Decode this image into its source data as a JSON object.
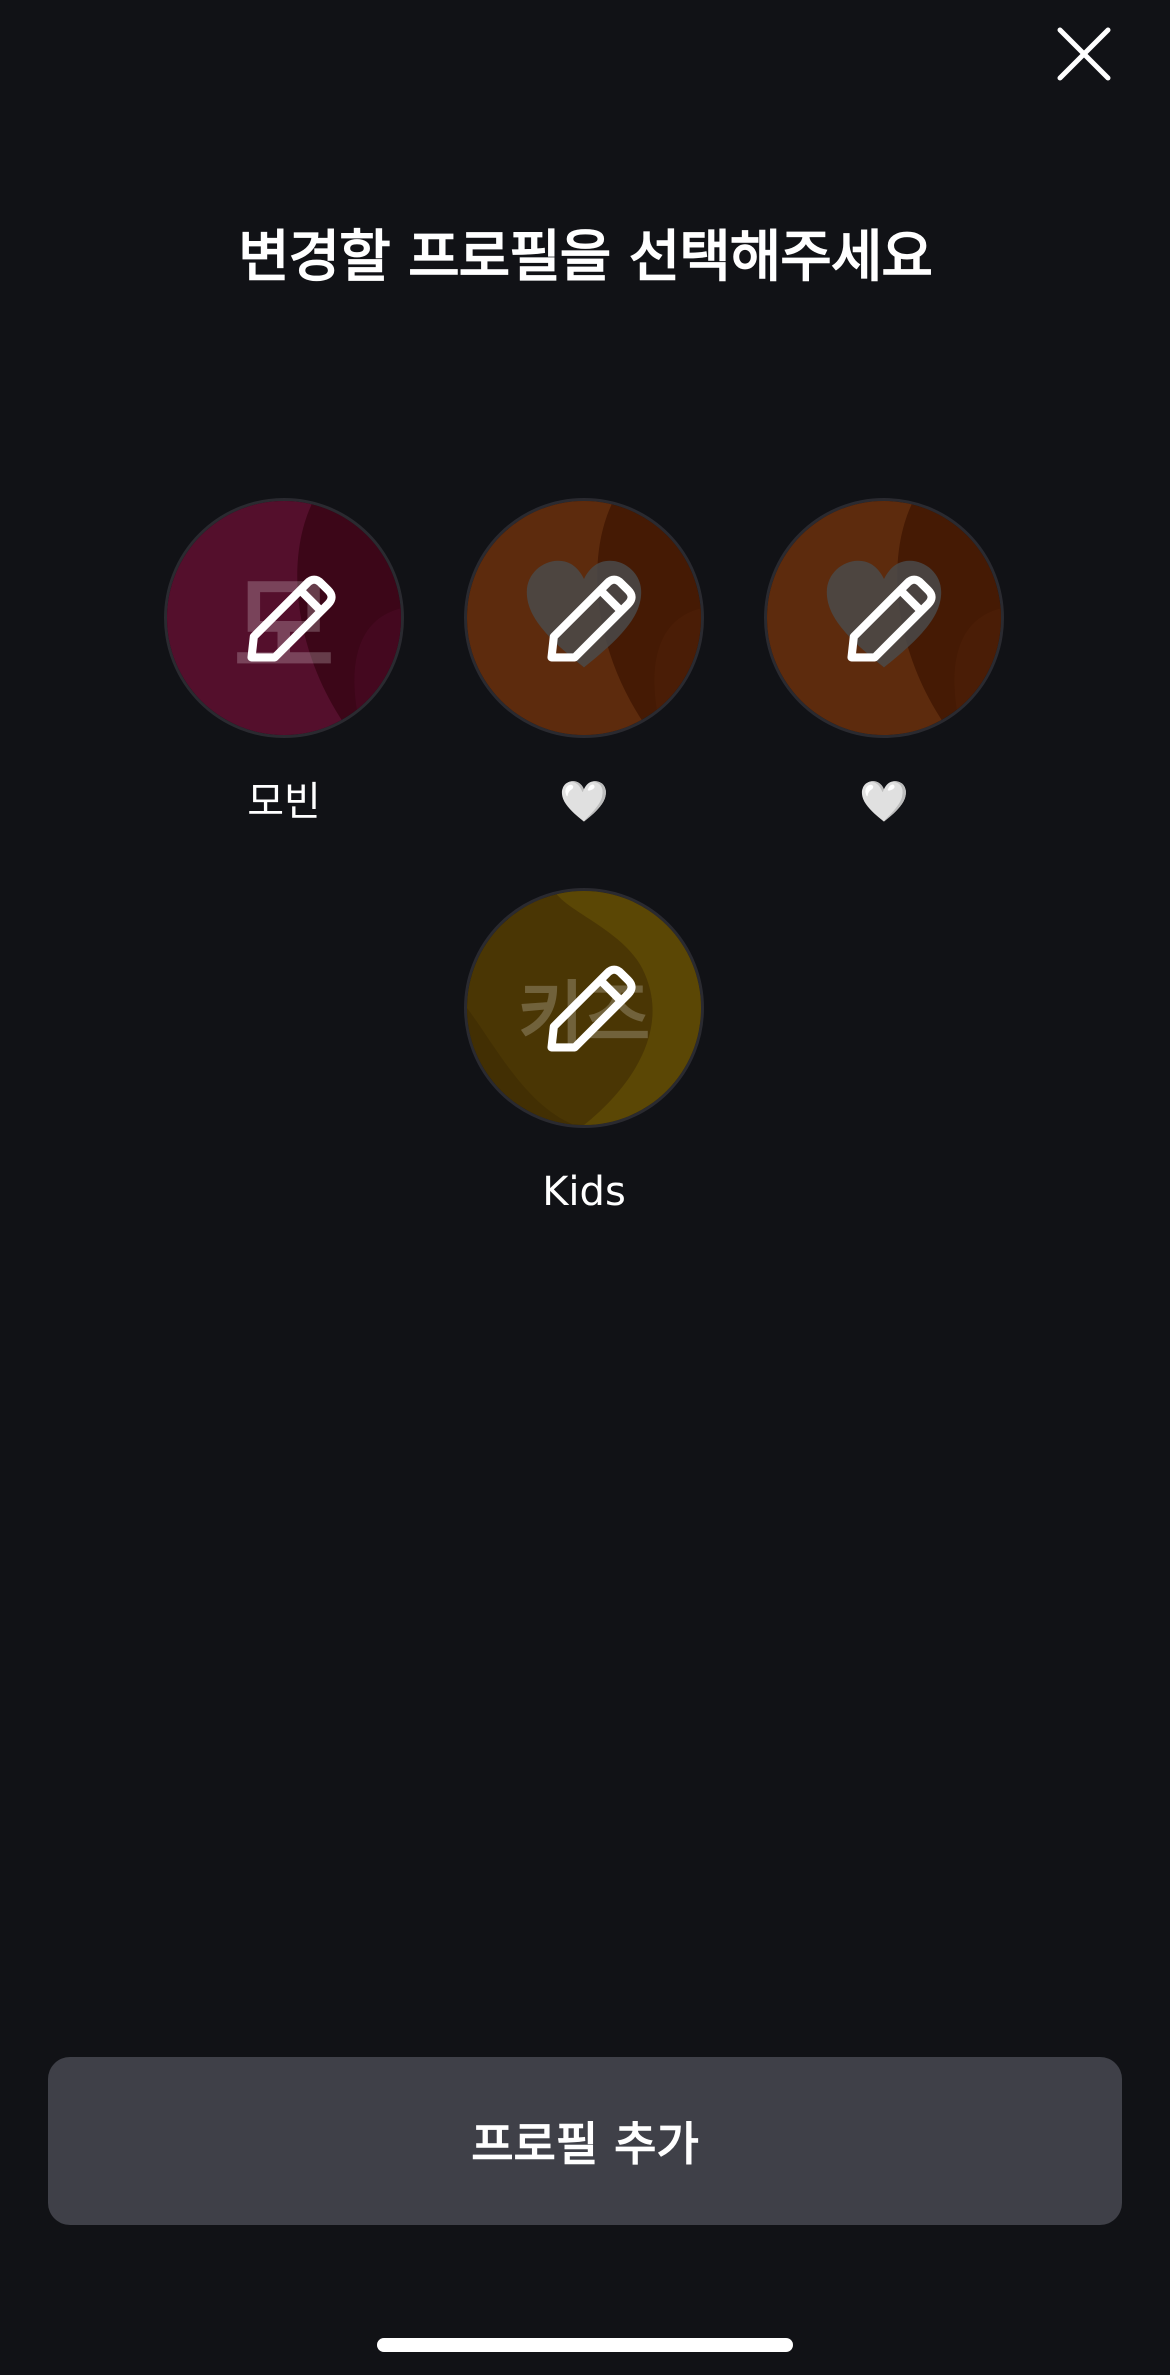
{
  "title": "변경할 프로필을 선택해주세요",
  "profiles": [
    {
      "name": "모빈",
      "avatar_glyph": "모",
      "avatar_color": "#4a0a22",
      "avatar_accent": "#6a1840",
      "icon": "pencil-icon"
    },
    {
      "name": "🤍",
      "avatar_icon": "heart-icon",
      "avatar_color": "#4a1e06",
      "avatar_accent": "#6e3212",
      "icon": "pencil-icon"
    },
    {
      "name": "🤍",
      "avatar_icon": "heart-icon",
      "avatar_color": "#4a1e06",
      "avatar_accent": "#6e3212",
      "icon": "pencil-icon"
    },
    {
      "name": "Kids",
      "avatar_glyph": "키즈",
      "avatar_color": "#4a3a04",
      "avatar_accent": "#6a5206",
      "icon": "pencil-icon"
    }
  ],
  "add_button": {
    "label": "프로필 추가"
  },
  "colors": {
    "background": "#111216",
    "button": "#3f4048"
  }
}
